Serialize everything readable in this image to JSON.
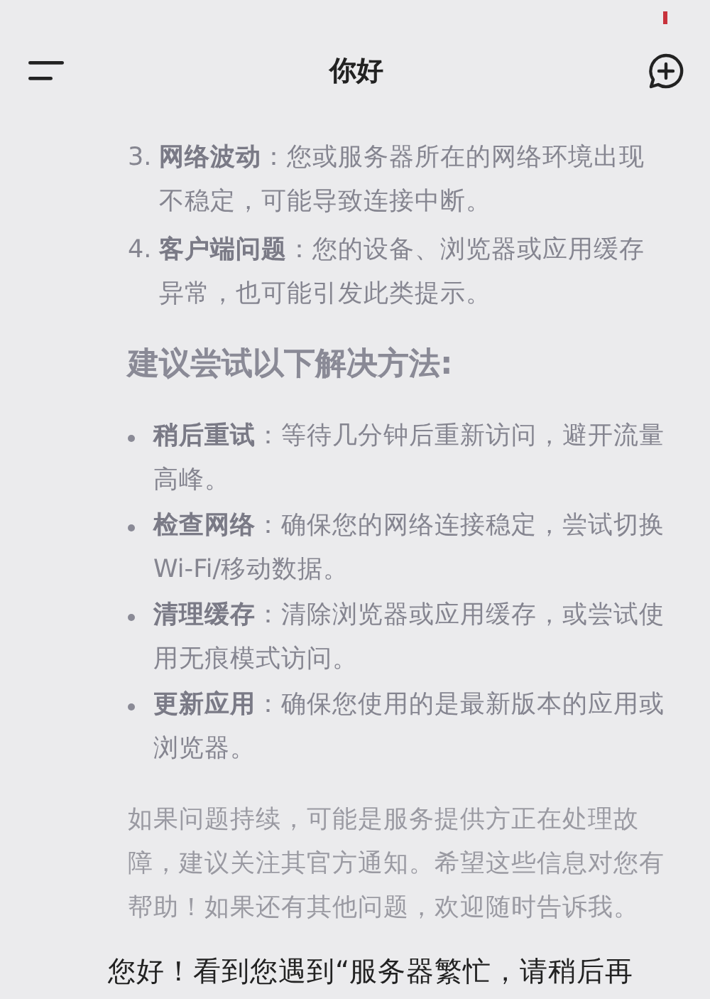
{
  "header": {
    "title": "你好"
  },
  "causes": [
    {
      "number": "3.",
      "term": "网络波动",
      "text": "：您或服务器所在的网络环境出现不稳定，可能导致连接中断。"
    },
    {
      "number": "4.",
      "term": "客户端问题",
      "text": "：您的设备、浏览器或应用缓存异常，也可能引发此类提示。"
    }
  ],
  "solutions_heading": "建议尝试以下解决方法:",
  "solutions": [
    {
      "term": "稍后重试",
      "text": "：等待几分钟后重新访问，避开流量高峰。"
    },
    {
      "term": "检查网络",
      "text": "：确保您的网络连接稳定，尝试切换Wi-Fi/移动数据。"
    },
    {
      "term": "清理缓存",
      "text": "：清除浏览器或应用缓存，或尝试使用无痕模式访问。"
    },
    {
      "term": "更新应用",
      "text": "：确保您使用的是最新版本的应用或浏览器。"
    }
  ],
  "closing": "如果问题持续，可能是服务提供方正在处理故障，建议关注其官方通知。希望这些信息对您有帮助！如果还有其他问题，欢迎随时告诉我。",
  "next_message": "您好！看到您遇到“服务器繁忙，请稍后再"
}
